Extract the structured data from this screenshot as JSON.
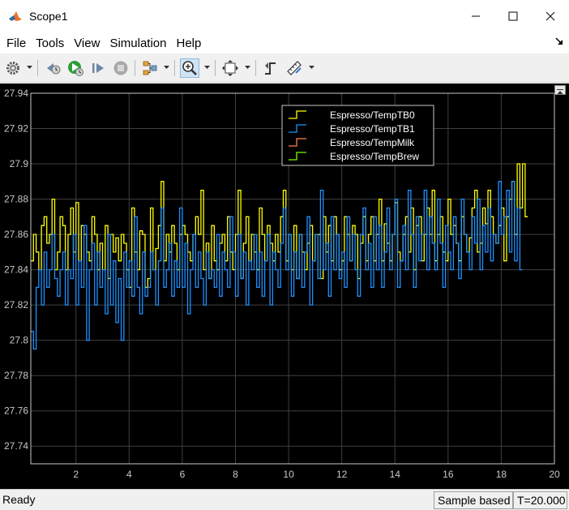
{
  "window": {
    "title": "Scope1"
  },
  "menu": [
    "File",
    "Tools",
    "View",
    "Simulation",
    "Help"
  ],
  "toolbar": {
    "icons": [
      "gear-icon",
      "step-back-icon",
      "run-icon",
      "step-forward-icon",
      "stop-icon",
      "signal-selector-icon",
      "zoom-in-icon",
      "fit-to-view-icon",
      "triggers-icon",
      "measurements-icon"
    ],
    "active": "zoom-in-icon"
  },
  "status": {
    "left": "Ready",
    "mode": "Sample based",
    "time": "T=20.000"
  },
  "colors": {
    "background": "#000000",
    "grid": "#404040",
    "axes": "#c8c8c8",
    "series": [
      "#ffff00",
      "#1e90ff",
      "#ff7f50",
      "#7cfc00"
    ]
  },
  "chart_data": {
    "type": "line",
    "step": true,
    "title": "",
    "xlabel": "",
    "ylabel": "",
    "xlim": [
      0.3,
      20
    ],
    "ylim": [
      27.73,
      27.94
    ],
    "xticks": [
      2,
      4,
      6,
      8,
      10,
      12,
      14,
      16,
      18,
      20
    ],
    "yticks": [
      27.74,
      27.76,
      27.78,
      27.8,
      27.82,
      27.84,
      27.86,
      27.88,
      27.9,
      27.92,
      27.94
    ],
    "ytick_labels": [
      "27.74",
      "27.76",
      "27.78",
      "27.8",
      "27.82",
      "27.84",
      "27.86",
      "27.88",
      "27.9",
      "27.92",
      "27.94"
    ],
    "xtick_labels": [
      "2",
      "4",
      "6",
      "8",
      "10",
      "12",
      "14",
      "16",
      "18",
      "20"
    ],
    "grid": true,
    "legend_position": "top-right",
    "x_start": 0.3,
    "x_step": 0.1,
    "series": [
      {
        "name": "Espresso/TempTB0",
        "values": [
          27.845,
          27.86,
          27.85,
          27.84,
          27.865,
          27.87,
          27.855,
          27.86,
          27.88,
          27.84,
          27.85,
          27.87,
          27.865,
          27.84,
          27.86,
          27.875,
          27.85,
          27.878,
          27.845,
          27.865,
          27.86,
          27.85,
          27.845,
          27.87,
          27.86,
          27.84,
          27.855,
          27.84,
          27.865,
          27.835,
          27.86,
          27.85,
          27.858,
          27.845,
          27.86,
          27.855,
          27.84,
          27.83,
          27.875,
          27.85,
          27.84,
          27.862,
          27.86,
          27.83,
          27.835,
          27.875,
          27.84,
          27.852,
          27.865,
          27.89,
          27.845,
          27.86,
          27.85,
          27.865,
          27.855,
          27.84,
          27.86,
          27.865,
          27.86,
          27.85,
          27.845,
          27.86,
          27.87,
          27.86,
          27.885,
          27.84,
          27.855,
          27.835,
          27.865,
          27.845,
          27.84,
          27.855,
          27.86,
          27.845,
          27.87,
          27.85,
          27.84,
          27.86,
          27.885,
          27.835,
          27.855,
          27.87,
          27.845,
          27.86,
          27.85,
          27.84,
          27.875,
          27.86,
          27.845,
          27.865,
          27.855,
          27.845,
          27.86,
          27.85,
          27.87,
          27.885,
          27.845,
          27.86,
          27.84,
          27.865,
          27.835,
          27.86,
          27.85,
          27.84,
          27.855,
          27.865,
          27.845,
          27.86,
          27.86,
          27.835,
          27.87,
          27.85,
          27.865,
          27.845,
          27.87,
          27.86,
          27.84,
          27.845,
          27.87,
          27.86,
          27.845,
          27.865,
          27.86,
          27.835,
          27.855,
          27.87,
          27.845,
          27.86,
          27.87,
          27.845,
          27.86,
          27.88,
          27.845,
          27.866,
          27.855,
          27.845,
          27.86,
          27.878,
          27.85,
          27.845,
          27.86,
          27.87,
          27.85,
          27.875,
          27.84,
          27.865,
          27.87,
          27.845,
          27.86,
          27.875,
          27.86,
          27.885,
          27.845,
          27.86,
          27.87,
          27.85,
          27.845,
          27.88,
          27.86,
          27.865,
          27.855,
          27.845,
          27.87,
          27.86,
          27.85,
          27.858,
          27.875,
          27.885,
          27.85,
          27.855,
          27.875,
          27.866,
          27.885,
          27.87,
          27.86,
          27.855,
          27.865,
          27.875,
          27.845,
          27.87,
          27.88,
          27.89,
          27.86,
          27.9,
          27.875,
          27.9,
          27.87
        ]
      },
      {
        "name": "Espresso/TempTB1",
        "values": [
          27.805,
          27.795,
          27.83,
          27.84,
          27.82,
          27.85,
          27.83,
          27.84,
          27.86,
          27.835,
          27.825,
          27.84,
          27.85,
          27.82,
          27.84,
          27.835,
          27.86,
          27.82,
          27.845,
          27.83,
          27.865,
          27.8,
          27.84,
          27.855,
          27.82,
          27.85,
          27.83,
          27.84,
          27.815,
          27.86,
          27.82,
          27.845,
          27.81,
          27.835,
          27.8,
          27.85,
          27.83,
          27.845,
          27.825,
          27.87,
          27.83,
          27.815,
          27.85,
          27.825,
          27.83,
          27.85,
          27.84,
          27.82,
          27.845,
          27.875,
          27.83,
          27.84,
          27.855,
          27.825,
          27.845,
          27.83,
          27.875,
          27.83,
          27.855,
          27.815,
          27.84,
          27.86,
          27.83,
          27.85,
          27.835,
          27.82,
          27.85,
          27.835,
          27.84,
          27.83,
          27.86,
          27.825,
          27.85,
          27.84,
          27.83,
          27.87,
          27.85,
          27.825,
          27.86,
          27.835,
          27.85,
          27.82,
          27.845,
          27.84,
          27.86,
          27.83,
          27.85,
          27.825,
          27.845,
          27.86,
          27.82,
          27.85,
          27.84,
          27.83,
          27.855,
          27.875,
          27.84,
          27.86,
          27.825,
          27.85,
          27.835,
          27.86,
          27.83,
          27.85,
          27.87,
          27.82,
          27.845,
          27.86,
          27.835,
          27.885,
          27.84,
          27.855,
          27.825,
          27.87,
          27.84,
          27.86,
          27.835,
          27.85,
          27.83,
          27.87,
          27.845,
          27.86,
          27.84,
          27.825,
          27.86,
          27.875,
          27.84,
          27.855,
          27.83,
          27.87,
          27.84,
          27.865,
          27.83,
          27.85,
          27.875,
          27.84,
          27.86,
          27.88,
          27.83,
          27.845,
          27.865,
          27.84,
          27.885,
          27.86,
          27.83,
          27.87,
          27.845,
          27.86,
          27.885,
          27.84,
          27.87,
          27.855,
          27.84,
          27.88,
          27.855,
          27.83,
          27.865,
          27.85,
          27.84,
          27.87,
          27.855,
          27.835,
          27.88,
          27.86,
          27.85,
          27.84,
          27.87,
          27.855,
          27.88,
          27.84,
          27.865,
          27.85,
          27.875,
          27.845,
          27.86,
          27.855,
          27.89,
          27.86,
          27.87,
          27.885,
          27.85,
          27.89,
          27.845,
          27.875,
          27.84
        ]
      },
      {
        "name": "Espresso/TempMilk",
        "values": []
      },
      {
        "name": "Espresso/TempBrew",
        "values": []
      }
    ]
  }
}
